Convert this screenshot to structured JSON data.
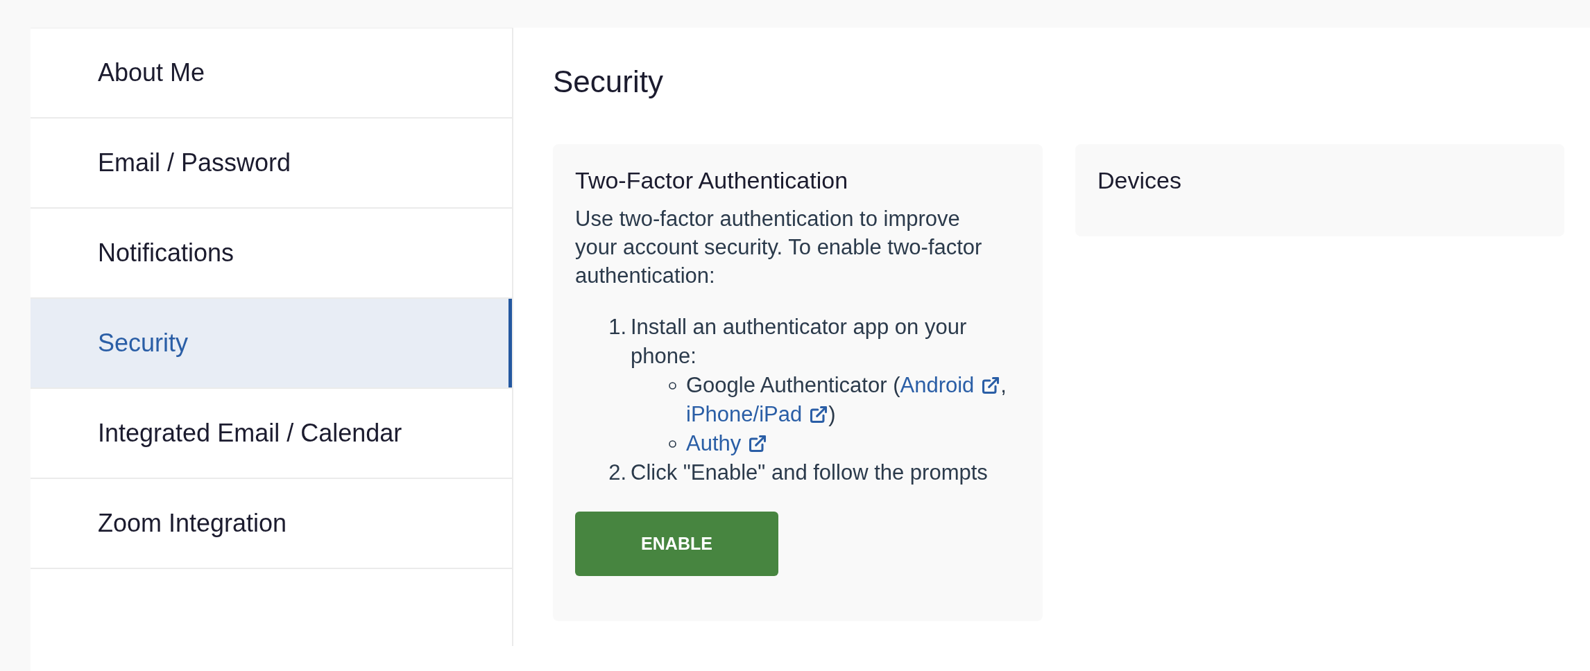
{
  "sidebar": {
    "items": [
      {
        "label": "About Me",
        "selected": false
      },
      {
        "label": "Email / Password",
        "selected": false
      },
      {
        "label": "Notifications",
        "selected": false
      },
      {
        "label": "Security",
        "selected": true
      },
      {
        "label": "Integrated Email / Calendar",
        "selected": false
      },
      {
        "label": "Zoom Integration",
        "selected": false
      }
    ]
  },
  "main": {
    "title": "Security",
    "two_factor": {
      "title": "Two-Factor Authentication",
      "description": "Use two-factor authentication to improve your account security. To enable two-factor authentication:",
      "steps": [
        {
          "number": "1.",
          "text": "Install an authenticator app on your phone:",
          "apps": [
            {
              "segments": [
                {
                  "kind": "text",
                  "text": "Google Authenticator ("
                },
                {
                  "kind": "link",
                  "text": "Android"
                },
                {
                  "kind": "text",
                  "text": ", "
                },
                {
                  "kind": "link",
                  "text": "iPhone/iPad"
                },
                {
                  "kind": "text",
                  "text": ")"
                }
              ]
            },
            {
              "segments": [
                {
                  "kind": "link",
                  "text": "Authy"
                }
              ]
            }
          ]
        },
        {
          "number": "2.",
          "text": "Click \"Enable\" and follow the prompts"
        }
      ],
      "button": "ENABLE"
    },
    "devices": {
      "title": "Devices"
    }
  }
}
